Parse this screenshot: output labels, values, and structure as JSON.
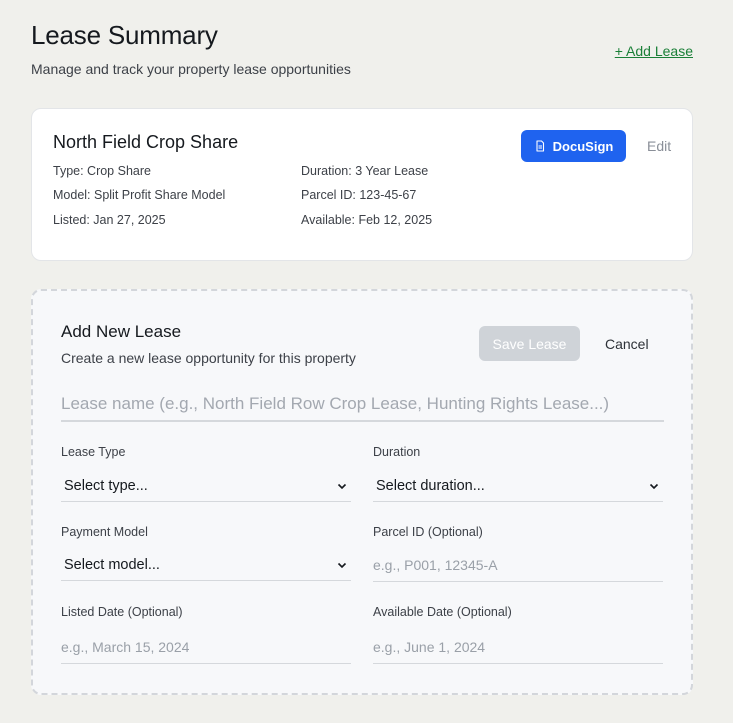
{
  "header": {
    "title": "Lease Summary",
    "subtitle": "Manage and track your property lease opportunities",
    "add_lease_label": "+ Add Lease"
  },
  "lease_card": {
    "title": "North Field Crop Share",
    "type": "Type: Crop Share",
    "model": "Model: Split Profit Share Model",
    "listed": "Listed: Jan 27, 2025",
    "duration": "Duration: 3 Year Lease",
    "parcel_id": "Parcel ID: 123-45-67",
    "available": "Available: Feb 12, 2025",
    "docusign_label": "DocuSign",
    "docusign_icon": "document-icon",
    "edit_label": "Edit"
  },
  "new_lease_form": {
    "title": "Add New Lease",
    "subtitle": "Create a new lease opportunity for this property",
    "save_label": "Save Lease",
    "cancel_label": "Cancel",
    "name_placeholder": "Lease name (e.g., North Field Row Crop Lease, Hunting Rights Lease...)",
    "lease_type": {
      "label": "Lease Type",
      "value": "Select type..."
    },
    "duration": {
      "label": "Duration",
      "value": "Select duration..."
    },
    "payment_model": {
      "label": "Payment Model",
      "value": "Select model..."
    },
    "parcel_id": {
      "label": "Parcel ID (Optional)",
      "placeholder": "e.g., P001, 12345-A"
    },
    "listed_date": {
      "label": "Listed Date (Optional)",
      "placeholder": "e.g., March 15, 2024"
    },
    "available_date": {
      "label": "Available Date (Optional)",
      "placeholder": "e.g., June 1, 2024"
    }
  },
  "colors": {
    "accent": "#1f63ef",
    "link_green": "#1a7f37",
    "disabled_button": "#cfd3d8"
  }
}
